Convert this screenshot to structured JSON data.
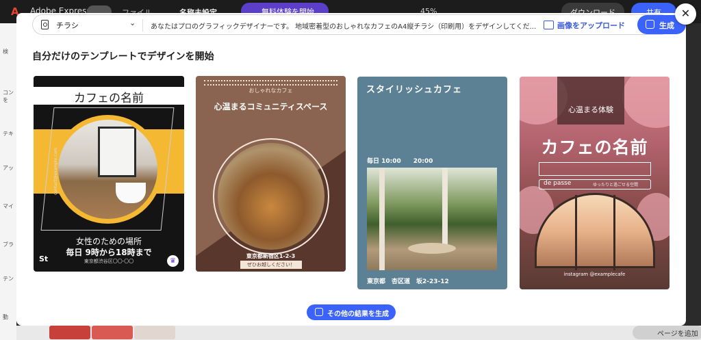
{
  "app": {
    "logo_text": "Adobe Express",
    "file_menu": "ファイル",
    "doc_title": "名称未設定",
    "trial_label": "無料体験を開始",
    "zoom": "45%",
    "download_label": "ダウンロード",
    "share_label": "共有",
    "page_button": "ページを追加",
    "left_items": [
      "検",
      "コンを",
      "テキ",
      "アッ",
      "マイ",
      "ブラ",
      "テン",
      "動"
    ]
  },
  "modal": {
    "prompt_bar": {
      "type_label": "チラシ",
      "prompt": "あなたはプロのグラフィックデザイナーです。 地域密着型のおしゃれなカフェのA4縦チラシ（印刷用）をデザインしてくだ...",
      "upload_label": "画像をアップロード",
      "generate_label": "生成"
    },
    "heading": "自分だけのテンプレートでデザインを開始",
    "more_label": "その他の結果を生成",
    "cards": [
      {
        "title": "カフェの名前",
        "contact": "contact@example.com",
        "line1": "女性のための場所",
        "line2": "毎日 9時から18時まで",
        "address": "東京都渋谷区〇〇-〇〇",
        "badge": "St"
      },
      {
        "small": "おしゃれなカフェ",
        "title": "心温まるコミュニティスペース",
        "address": "東京都新宿区1-2-3",
        "pill": "ぜひお越しください！"
      },
      {
        "title": "スタイリッシュカフェ",
        "hours": "毎日 10:00　　20:00",
        "address": "東京都　杏区道　坂2-23-12"
      },
      {
        "top": "心温まる体験",
        "title": "カフェの名前",
        "pill": "de passe",
        "pill_tail": "ゆったりと過ごせる空間",
        "handle": "instagram @examplecafe"
      }
    ]
  }
}
